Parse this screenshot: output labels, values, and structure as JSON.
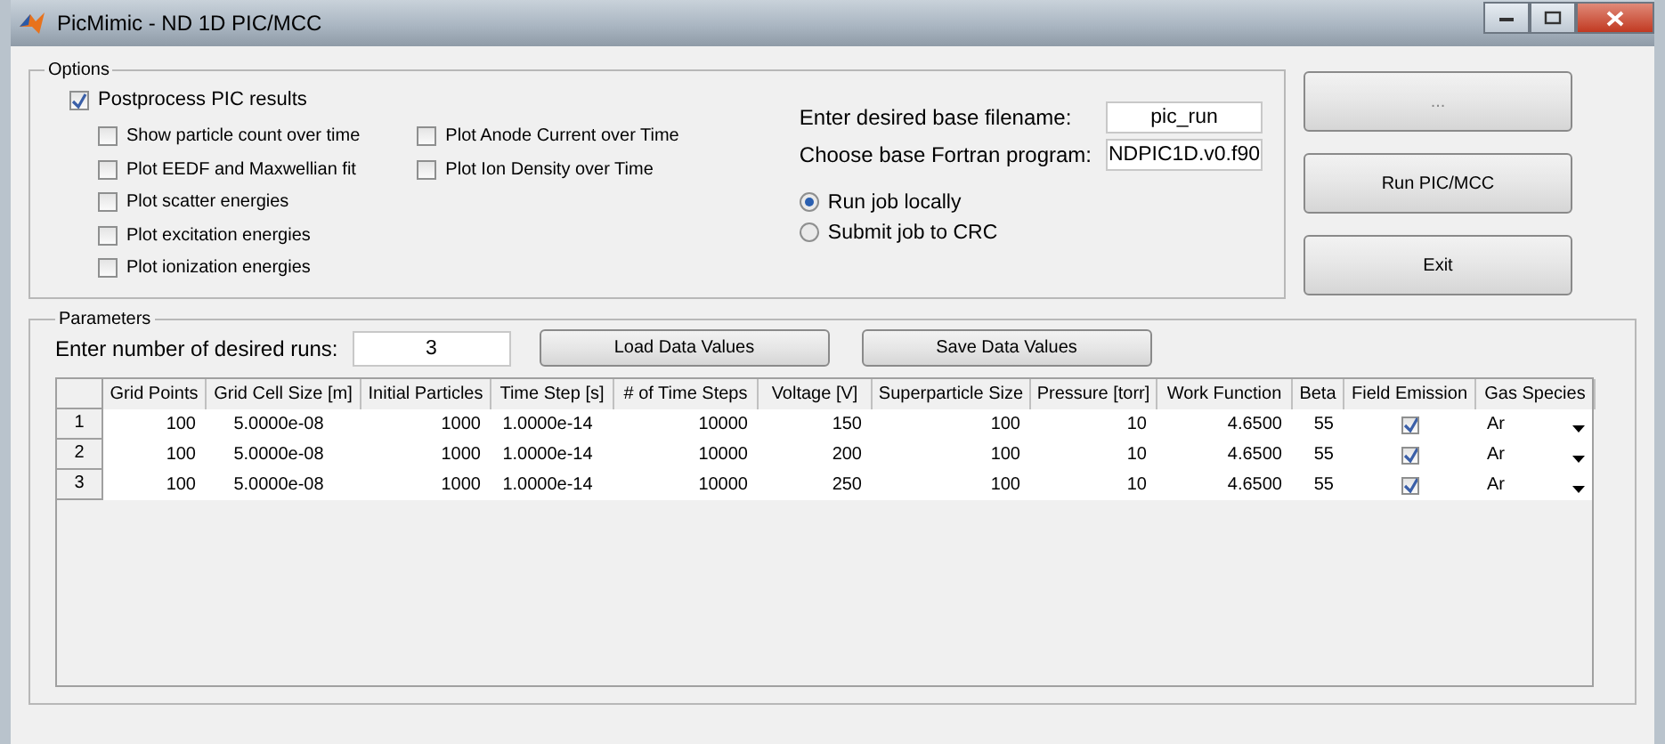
{
  "window": {
    "title": "PicMimic - ND 1D PIC/MCC"
  },
  "options": {
    "title": "Options",
    "postprocess": {
      "label": "Postprocess PIC results",
      "checked": true
    },
    "plot_columns": [
      [
        {
          "label": "Show particle count over time",
          "checked": false
        },
        {
          "label": "Plot EEDF and Maxwellian fit",
          "checked": false
        },
        {
          "label": "Plot scatter energies",
          "checked": false
        },
        {
          "label": "Plot excitation energies",
          "checked": false
        },
        {
          "label": "Plot ionization energies",
          "checked": false
        }
      ],
      [
        {
          "label": "Plot Anode Current over Time",
          "checked": false
        },
        {
          "label": "Plot Ion Density over Time",
          "checked": false
        }
      ]
    ],
    "fields": [
      {
        "label": "Enter desired base filename:",
        "value": "pic_run"
      },
      {
        "label": "Choose base Fortran program:",
        "value": "NDPIC1D.v0.f90"
      }
    ],
    "radios": [
      {
        "label": "Run job locally",
        "selected": true
      },
      {
        "label": "Submit job to CRC",
        "selected": false
      }
    ]
  },
  "side_buttons": [
    "...",
    "Run PIC/MCC",
    "Exit"
  ],
  "parameters": {
    "title": "Parameters",
    "runs_label": "Enter number of desired runs:",
    "runs_value": "3",
    "buttons": [
      "Load Data Values",
      "Save Data Values"
    ],
    "table": {
      "columns": [
        "Grid Points",
        "Grid Cell Size [m]",
        "Initial Particles",
        "Time Step [s]",
        "# of Time Steps",
        "Voltage [V]",
        "Superparticle Size",
        "Pressure [torr]",
        "Work Function",
        "Beta",
        "Field Emission",
        "Gas Species"
      ],
      "rows": [
        {
          "header": "1",
          "cells": [
            "100",
            "5.0000e-08",
            "1000",
            "1.0000e-14",
            "10000",
            "150",
            "100",
            "10",
            "4.6500",
            "55"
          ],
          "field_emission": true,
          "gas_species": "Ar"
        },
        {
          "header": "2",
          "cells": [
            "100",
            "5.0000e-08",
            "1000",
            "1.0000e-14",
            "10000",
            "200",
            "100",
            "10",
            "4.6500",
            "55"
          ],
          "field_emission": true,
          "gas_species": "Ar"
        },
        {
          "header": "3",
          "cells": [
            "100",
            "5.0000e-08",
            "1000",
            "1.0000e-14",
            "10000",
            "250",
            "100",
            "10",
            "4.6500",
            "55"
          ],
          "field_emission": true,
          "gas_species": "Ar"
        }
      ]
    }
  }
}
